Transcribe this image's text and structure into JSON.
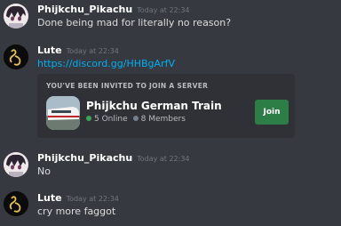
{
  "messages": [
    {
      "author": "Phijkchu_Pikachu",
      "timestamp": "Today at 22:34",
      "text": "Done being mad for literally no reason?"
    },
    {
      "author": "Lute",
      "timestamp": "Today at 22:34",
      "text": "https://discord.gg/HHBgArfV"
    },
    {
      "author": "Phijkchu_Pikachu",
      "timestamp": "Today at 22:34",
      "text": "No"
    },
    {
      "author": "Lute",
      "timestamp": "Today at 22:34",
      "text": "cry more faggot"
    }
  ],
  "invite": {
    "heading": "YOU'VE BEEN INVITED TO JOIN A SERVER",
    "server_name": "Phijkchu German Train",
    "online": "5 Online",
    "members": "8 Members",
    "join_label": "Join"
  },
  "colors": {
    "background": "#36393f",
    "embed": "#2f3136",
    "link": "#00aff4",
    "join_button": "#2d7d46",
    "online_dot": "#3ba55d"
  }
}
